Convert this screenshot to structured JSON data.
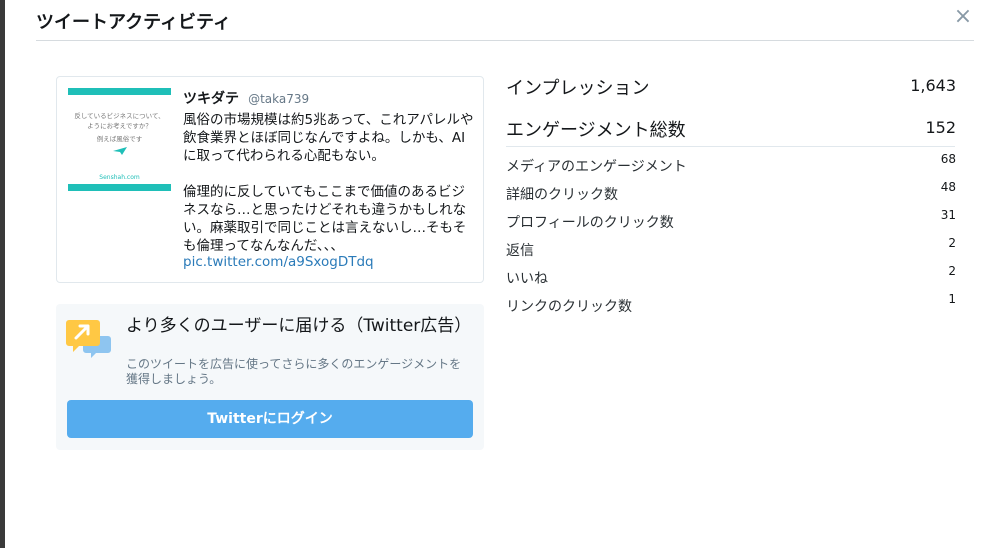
{
  "header": {
    "title": "ツイートアクティビティ",
    "close_symbol": "×"
  },
  "tweet": {
    "name": "ツキダテ",
    "handle": "@taka739",
    "body": "風俗の市場規模は約5兆あって、これアパレルや飲食業界とほぼ同じなんですよね。しかも、AIに取って代わられる心配もない。\n\n倫理的に反していてもここまで価値のあるビジネスなら…と思ったけどそれも違うかもしれない。麻薬取引で同じことは言えないし…そもそも倫理ってなんなんだ、、、",
    "link": "pic.twitter.com/a9SxogDTdq",
    "thumbnail": {
      "line1": "反しているビジネスについて、",
      "line2": "ようにお考えですか？",
      "line3": "例えば風俗です",
      "brand": "Senshah.com",
      "accent_color": "#1fbfb8"
    }
  },
  "promo": {
    "title": "より多くのユーザーに届ける（Twitter広告）",
    "description": "このツイートを広告に使ってさらに多くのエンゲージメントを獲得しましょう。",
    "button": "Twitterにログイン",
    "button_color": "#55acee",
    "icon": "speech-bubble-arrow-icon"
  },
  "stats": {
    "impressions_label": "インプレッション",
    "impressions_value": "1,643",
    "engagements_label": "エンゲージメント総数",
    "engagements_value": "152",
    "breakdown": [
      {
        "label": "メディアのエンゲージメント",
        "value": "68"
      },
      {
        "label": "詳細のクリック数",
        "value": "48"
      },
      {
        "label": "プロフィールのクリック数",
        "value": "31"
      },
      {
        "label": "返信",
        "value": "2"
      },
      {
        "label": "いいね",
        "value": "2"
      },
      {
        "label": "リンクのクリック数",
        "value": "1"
      }
    ]
  }
}
